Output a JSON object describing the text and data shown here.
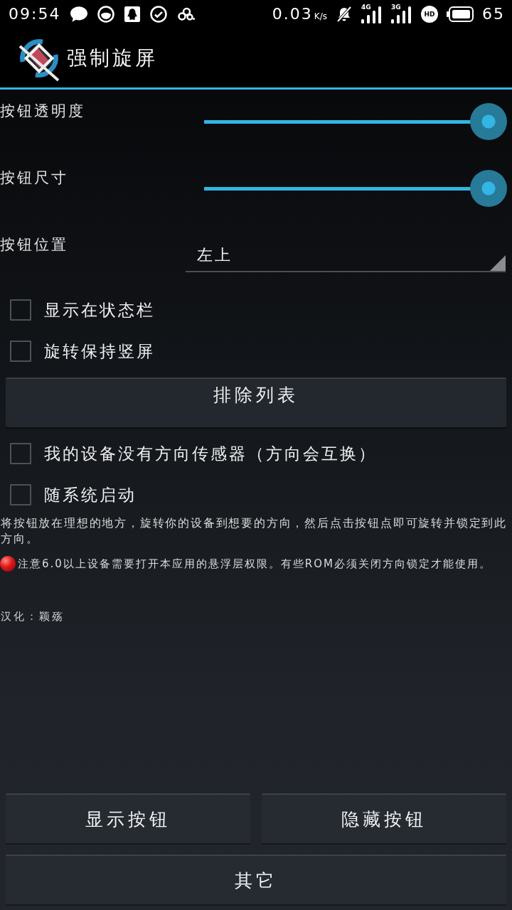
{
  "status_bar": {
    "time": "09:54",
    "speed": "0.03",
    "speed_unit": "K/s",
    "signals": [
      {
        "network": "4G"
      },
      {
        "network": "3G"
      }
    ],
    "hd_label": "HD",
    "battery": "65"
  },
  "action_bar": {
    "title": "强制旋屏"
  },
  "settings": [
    {
      "kind": "slider",
      "label": "按钮透明度",
      "level": 1
    },
    {
      "kind": "slider",
      "label": "按钮尺寸",
      "level": 1
    },
    {
      "kind": "dropdown",
      "label": "按钮位置",
      "value": "左上"
    },
    {
      "kind": "checkbox",
      "label": "显示在状态栏",
      "checked": false
    },
    {
      "kind": "checkbox",
      "label": "旋转保持竖屏",
      "checked": false
    },
    {
      "kind": "button",
      "label": "排除列表"
    },
    {
      "kind": "checkbox",
      "label": "我的设备没有方向传感器（方向会互换）",
      "checked": false
    },
    {
      "kind": "checkbox",
      "label": "随系统启动",
      "checked": false
    }
  ],
  "instructions": "将按钮放在理想的地方，旋转你的设备到想要的方向，然后点击按钮点即可旋转并锁定到此方向。",
  "notice": "注意6.0以上设备需要打开本应用的悬浮层权限。有些ROM必须关闭方向锁定才能使用。",
  "credit": "汉化：颖殇",
  "button_rows": [
    [
      "显示按钮",
      "隐藏按钮"
    ],
    [
      "其它"
    ]
  ]
}
